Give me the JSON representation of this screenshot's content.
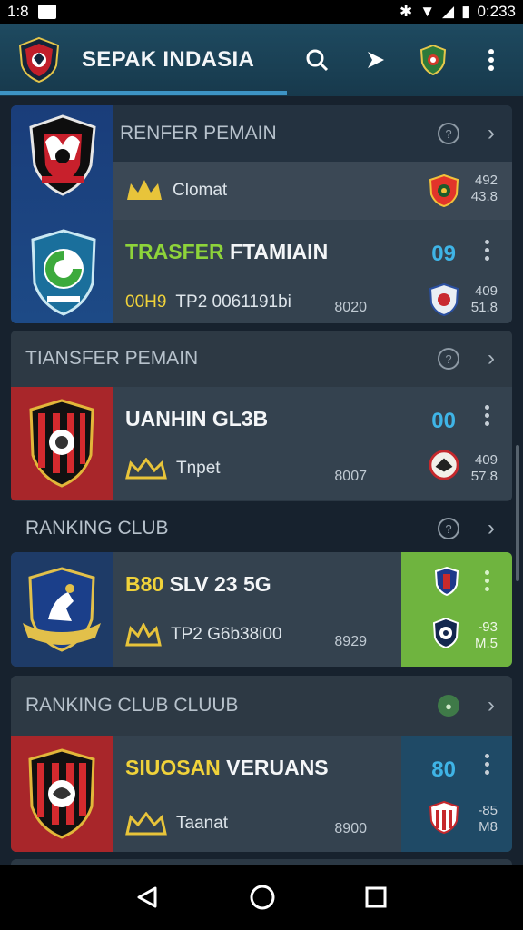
{
  "status_bar": {
    "time_left": "1:8",
    "time_right": "0:233"
  },
  "app": {
    "title": "SEPAK INDASIA",
    "actions": [
      "search-icon",
      "share-icon",
      "club-badge-icon",
      "more-icon"
    ]
  },
  "sections": [
    {
      "header": "RENFER PEMAIN",
      "rows": [
        {
          "name": "",
          "sub_label": "Clomat",
          "code": "",
          "score": "",
          "stat": [
            "492",
            "43.8"
          ]
        },
        {
          "name_green": "TRASFER",
          "name": " FTAMIAIN",
          "sub_label": "TP2 0061191bi",
          "code": "00H9",
          "number": "8020",
          "score": "09",
          "stat": [
            "409",
            "51.8"
          ]
        }
      ]
    },
    {
      "header": "TIANSFER PEMAIN",
      "rows": [
        {
          "name": "UANHIN GL3B",
          "sub_label": "Tnpet",
          "number": "8007",
          "score": "00",
          "stat": [
            "409",
            "57.8"
          ]
        }
      ]
    },
    {
      "header": "RANKING CLUB",
      "rows": [
        {
          "name_yellow": "B80",
          "name": " SLV 23 5G",
          "sub_label": "TP2 G6b38i00",
          "number": "8929",
          "score": "",
          "stat": [
            "-93",
            "M.5"
          ]
        }
      ]
    },
    {
      "header": "RANKING CLUB CLUUB",
      "rows": [
        {
          "name_yellow": "SIUOSAN",
          "name": " VERUANS",
          "sub_label": "Taanat",
          "number": "8900",
          "score": "80",
          "stat": [
            "-85",
            "M8"
          ]
        }
      ]
    }
  ],
  "colors": {
    "accent": "#3d93c4",
    "score": "#3fb4e6",
    "green_ribbon": "#6fb43f",
    "name_green": "#8ed43a",
    "name_yellow": "#f0d23a"
  }
}
